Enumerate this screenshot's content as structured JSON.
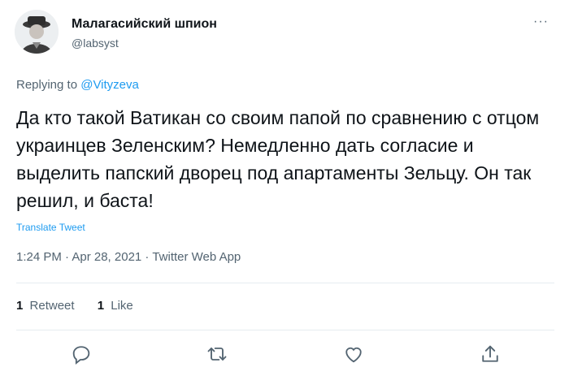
{
  "user": {
    "display_name": "Малагасийский шпион",
    "handle": "@labsyst"
  },
  "more_label": "···",
  "reply": {
    "prefix": "Replying to",
    "mention": "@Vityzeva"
  },
  "tweet": {
    "text": "Да кто такой Ватикан со своим папой по сравнению с отцом украинцев Зеленским? Немедленно дать согласие и выделить папский дворец под апартаменты Зельцу. Он так решил, и баста!",
    "translate_label": "Translate Tweet",
    "meta": "1:24 PM · Apr 28, 2021 · Twitter Web App"
  },
  "stats": {
    "retweets_count": "1",
    "retweets_label": "Retweet",
    "likes_count": "1",
    "likes_label": "Like"
  },
  "actions": [
    "reply-icon",
    "retweet-icon",
    "like-icon",
    "share-icon"
  ],
  "colors": {
    "accent": "#1d9bf0",
    "text": "#0f1419",
    "secondary": "#536471"
  }
}
